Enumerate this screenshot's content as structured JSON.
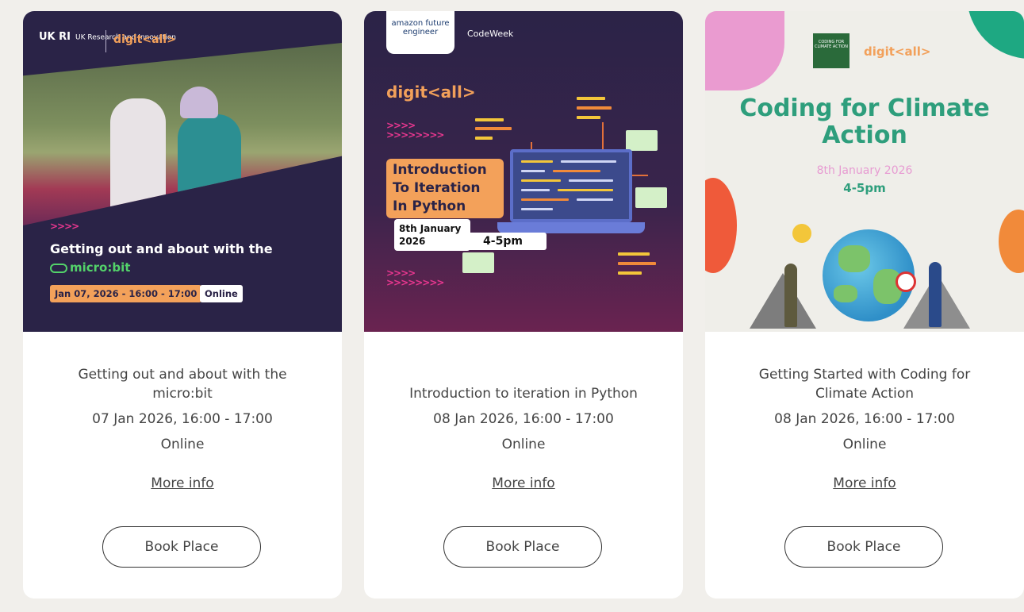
{
  "cards": [
    {
      "banner": {
        "org": "UK Research and Innovation",
        "org_short": "UK RI",
        "brand": "digit<all>",
        "arrows": ">>>>",
        "headline": "Getting out and about with the",
        "product": "micro:bit",
        "date_pill": "Jan 07, 2026 - 16:00 - 17:00",
        "mode_pill": "Online"
      },
      "title": "Getting out and about with the micro:bit",
      "datetime": "07 Jan 2026, 16:00 - 17:00",
      "location": "Online",
      "more_info": "More info",
      "book_label": "Book Place"
    },
    {
      "banner": {
        "sponsor": "amazon future engineer",
        "partner": "CodeWeek",
        "brand": "digit<all>",
        "arrows_top": ">>>>\n>>>>>>>>",
        "arrows_bottom": ">>>>\n>>>>>>>>",
        "headline": "Introduction To Iteration In Python",
        "date": "8th January 2026",
        "time": "4-5pm"
      },
      "title": "Introduction to iteration in Python",
      "datetime": "08 Jan 2026, 16:00 - 17:00",
      "location": "Online",
      "more_info": "More info",
      "book_label": "Book Place"
    },
    {
      "banner": {
        "badge": "CODING FOR CLIMATE ACTION",
        "brand": "digit<all>",
        "headline": "Coding for Climate Action",
        "date": "8th January 2026",
        "time": "4-5pm"
      },
      "title": "Getting Started with Coding for Climate Action",
      "datetime": "08 Jan 2026, 16:00 - 17:00",
      "location": "Online",
      "more_info": "More info",
      "book_label": "Book Place"
    }
  ],
  "colors": {
    "page_bg": "#f1efeb",
    "brand_orange": "#f3a15a",
    "navy": "#2a2347",
    "climate_green": "#2e9e7c"
  }
}
